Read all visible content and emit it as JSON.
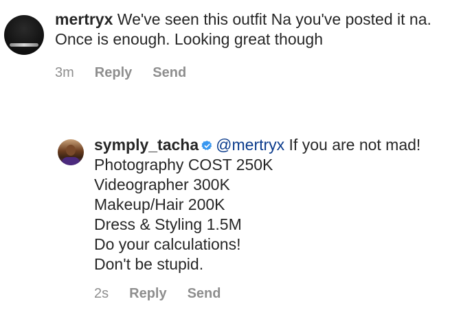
{
  "comment1": {
    "username": "mertryx",
    "text": "We've seen this outfit Na you've posted it na. Once is enough. Looking great though",
    "time": "3m",
    "reply_label": "Reply",
    "send_label": "Send"
  },
  "comment2": {
    "username": "symply_tacha",
    "verified_icon": "verified-badge-icon",
    "verified_color": "#3897f0",
    "mention": "@mertryx",
    "first_line_text": "If you are not mad! Photography COST 250K",
    "lines": [
      "Videographer 300K",
      "Makeup/Hair 200K",
      "Dress & Styling 1.5M",
      "Do your calculations!",
      "Don't be stupid."
    ],
    "time": "2s",
    "reply_label": "Reply",
    "send_label": "Send"
  }
}
